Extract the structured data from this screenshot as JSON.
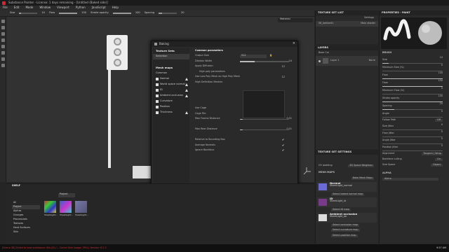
{
  "window": {
    "title": "Substance Painter - License: 1 days remaining - [Untitled (Baked side)]"
  },
  "menu": [
    "File",
    "Edit",
    "Mode",
    "Window",
    "Viewport",
    "Python",
    "JavaScript",
    "Help"
  ],
  "toolbar": {
    "size_label": "Size",
    "flow_label": "Flow",
    "stroke_opacity_label": "Stroke opacity",
    "spacing_label": "Spacing",
    "size_value": "10",
    "flow_value": "100",
    "opacity_value": "100",
    "spacing_value": "20"
  },
  "viewport": {
    "mode": "Material"
  },
  "dialog": {
    "title": "Baking",
    "settings_header": "Texture Sets",
    "selection_label": "Selection",
    "mesh_maps_header": "Mesh maps",
    "common_label": "Common",
    "maps": [
      {
        "label": "Normal",
        "warn": true
      },
      {
        "label": "World space normal",
        "warn": true
      },
      {
        "label": "ID",
        "warn": true
      },
      {
        "label": "Ambient occlusion",
        "warn": true
      },
      {
        "label": "Curvature",
        "warn": false
      },
      {
        "label": "Position",
        "warn": false
      },
      {
        "label": "Thickness",
        "warn": true
      }
    ],
    "common_params_header": "Common parameters",
    "rows": [
      {
        "label": "Output Size",
        "value": "512",
        "type": "select"
      },
      {
        "label": "Dilation Width",
        "value": "16",
        "type": "slider",
        "fill": 0.3
      },
      {
        "label": "Apply Diffusion",
        "value": "",
        "type": "check"
      },
      {
        "label": "High poly parameters",
        "value": "",
        "type": "header"
      },
      {
        "label": "Use Low Poly Mesh as High Poly Mesh",
        "value": "",
        "type": "check"
      },
      {
        "label": "High Definition Meshes",
        "value": "",
        "type": "none"
      },
      {
        "label": "",
        "value": "",
        "type": "none"
      },
      {
        "label": "",
        "value": "",
        "type": "none"
      },
      {
        "label": "",
        "value": "",
        "type": "none"
      },
      {
        "label": "",
        "value": "",
        "type": "none"
      },
      {
        "label": "Use Cage",
        "value": "",
        "type": "check"
      },
      {
        "label": "Cage File",
        "value": "",
        "type": "none"
      },
      {
        "label": "Max Frontal Distance",
        "value": "0.01",
        "type": "slider",
        "fill": 0.05
      },
      {
        "label": "",
        "value": "",
        "type": "none"
      },
      {
        "label": "Max Rear Distance",
        "value": "0.01",
        "type": "slider",
        "fill": 0.05
      },
      {
        "label": "",
        "value": "",
        "type": "none"
      },
      {
        "label": "Relative to Bounding Box",
        "value": "",
        "type": "tick"
      },
      {
        "label": "Average Normals",
        "value": "",
        "type": "tick"
      },
      {
        "label": "Ignore Backface",
        "value": "",
        "type": "tick"
      }
    ],
    "disable_help": "Disable help",
    "footer_status": "7 textures selected for baking",
    "cancel": "Cancel",
    "save_settings": "Save settings",
    "bake_button": "Bake selected textures"
  },
  "texture_set_list": {
    "title": "TEXTURE SET LIST",
    "settings": "Settings",
    "item": "06_lambert1",
    "shader": "Main shader"
  },
  "layers": {
    "title": "LAYERS",
    "channel": "Base Col",
    "layer": "Layer 1",
    "blend": "Norm",
    "opacity": "100"
  },
  "texture_set_settings": {
    "title": "TEXTURE SET SETTINGS",
    "uv_padding": "UV padding",
    "uv_value": "3D Space Neighbor",
    "mesh_maps": "MESH MAPS",
    "bake_btn": "Bake Mesh Maps",
    "maps": [
      {
        "name": "Normal",
        "file": "SheetLight_normal",
        "action": "Select baked normal map"
      },
      {
        "name": "ID",
        "file": "SheetLight_id",
        "action": "Select ID map"
      },
      {
        "name": "Ambient occlusion",
        "file": "SheetLight_ao",
        "action": "Select occlusion map"
      }
    ],
    "curvature_btn": "Select curvature map",
    "position_btn": "Select position map"
  },
  "properties": {
    "title": "PROPERTIES - PAINT",
    "brush": "BRUSH",
    "params": [
      {
        "label": "Size",
        "value": "10",
        "fill": 0.1
      },
      {
        "label": "Minimum Size (%)",
        "value": "0",
        "fill": 0.0
      },
      {
        "label": "Flow",
        "value": "100",
        "fill": 1.0
      },
      {
        "label": "Flow",
        "value": "100",
        "fill": 1.0
      },
      {
        "label": "Minimum Flow (%)",
        "value": "0",
        "fill": 0.0
      },
      {
        "label": "Stroke opacity",
        "value": "100",
        "fill": 1.0
      },
      {
        "label": "Spacing",
        "value": "20",
        "fill": 0.2
      },
      {
        "label": "Angle",
        "value": "0",
        "fill": 0.0
      }
    ],
    "follow_path": "Follow Path",
    "off": "Off",
    "jitters": [
      {
        "label": "Size Jitter",
        "value": "0"
      },
      {
        "label": "Flow Jitter",
        "value": "0"
      },
      {
        "label": "Angle Jitter",
        "value": "0"
      },
      {
        "label": "Position Jitter",
        "value": "0"
      }
    ],
    "alignment": "Alignment",
    "alignment_val": "Tangent | Wrap",
    "backface": "Backface culling",
    "backface_val": "On",
    "size_space": "Size Space",
    "size_space_val": "Object",
    "alpha": "ALPHA",
    "alpha_val": "Alpha"
  },
  "shelf": {
    "title": "SHELF",
    "tab": "Project",
    "categories": [
      "All",
      "Project",
      "Alphas",
      "Grunges",
      "Procedurals",
      "Textures",
      "Hard Surfaces",
      "Skin"
    ],
    "thumbs": [
      "SheetLight...",
      "SheetLight...",
      "SheetLight..."
    ]
  },
  "status": {
    "text": "[Scene 3D] Failed to load substance: file:///C:/... Cache Disk Usage: 39% | Version: 6.2.2",
    "time": "9:57 AM",
    "date": "4/6/2021"
  }
}
